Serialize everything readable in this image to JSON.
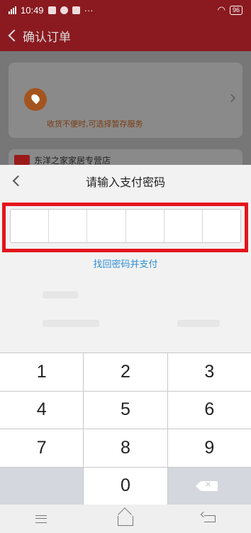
{
  "status_bar": {
    "time": "10:49",
    "battery": "96",
    "icons": [
      "signal-icon",
      "wifi-icon",
      "battery-icon"
    ]
  },
  "header": {
    "title": "确认订单"
  },
  "address": {
    "note": "收货不便时,可选择暂存服务"
  },
  "shop": {
    "name": "东洋之家家居专营店"
  },
  "payment": {
    "title": "请输入支付密码",
    "pin_cells": [
      "",
      "",
      "",
      "",
      "",
      ""
    ],
    "forgot_link": "找回密码并支付"
  },
  "keypad": {
    "keys": [
      "1",
      "2",
      "3",
      "4",
      "5",
      "6",
      "7",
      "8",
      "9",
      "",
      "0",
      ""
    ]
  },
  "colors": {
    "highlight": "#e4141b",
    "link": "#2d8fd6",
    "header": "#8a1a20"
  }
}
